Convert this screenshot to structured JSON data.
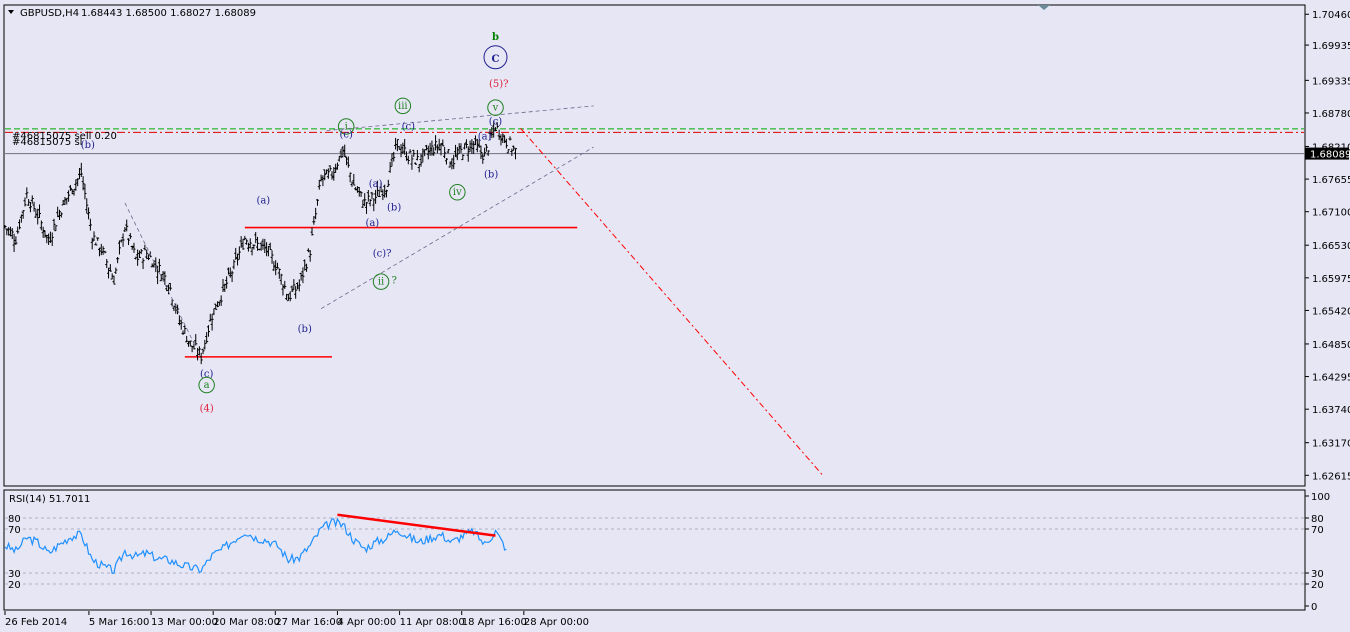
{
  "header": {
    "symbol": "GBPUSD,H4",
    "ohlc": "1.68443 1.68500 1.68027 1.68089"
  },
  "price_panel": {
    "price_labels": [
      "1.70460",
      "1.69935",
      "1.69335",
      "1.68780",
      "1.68210",
      "1.67655",
      "1.67100",
      "1.66530",
      "1.65975",
      "1.65420",
      "1.64850",
      "1.64295",
      "1.63740",
      "1.63170",
      "1.62615"
    ],
    "price_values": [
      1.7046,
      1.69935,
      1.69335,
      1.6878,
      1.6821,
      1.67655,
      1.671,
      1.6653,
      1.65975,
      1.6542,
      1.6485,
      1.64295,
      1.6374,
      1.6317,
      1.62615
    ],
    "current_price_label": "1.68089",
    "current_price": 1.68089,
    "order_lines": [
      {
        "label": "#46815075 sell 0.20",
        "price": 1.6851,
        "color": "#00aa00"
      },
      {
        "label": "#46815075 sl",
        "price": 1.6845,
        "color": "#e00000"
      }
    ],
    "levels": [
      {
        "price": 1.6683,
        "from_day": 22.0,
        "to_day": 52.5,
        "color": "#ff0000"
      },
      {
        "price": 1.6463,
        "from_day": 16.5,
        "to_day": 30.0,
        "color": "#ff0000"
      }
    ],
    "projection": {
      "from_day": 47.3,
      "from_price": 1.6852,
      "to_day": 75.0,
      "to_price": 1.6262,
      "color": "#ff0000"
    },
    "channel_lines": [
      {
        "from_day": 29.5,
        "from_price": 1.6848,
        "to_day": 54.0,
        "to_price": 1.689
      },
      {
        "from_day": 29.0,
        "from_price": 1.6545,
        "to_day": 54.0,
        "to_price": 1.682
      },
      {
        "from_day": 11.0,
        "from_price": 1.6725,
        "to_day": 17.5,
        "to_price": 1.648
      }
    ],
    "wave_labels": [
      {
        "text": "b",
        "day": 45.0,
        "price": 1.7002,
        "color": "#008000",
        "size": 15,
        "circled": false
      },
      {
        "text": "C",
        "day": 45.0,
        "price": 1.6965,
        "color": "#202090",
        "size": 14,
        "circled": true
      },
      {
        "text": "(5)?",
        "day": 45.3,
        "price": 1.6922,
        "color": "#e0203a",
        "size": 11,
        "circled": false
      },
      {
        "text": "v",
        "day": 45.0,
        "price": 1.6882,
        "color": "#208020",
        "size": 9,
        "circled": true
      },
      {
        "text": "(c)",
        "day": 45.0,
        "price": 1.6858,
        "color": "#202090",
        "size": 10,
        "circled": false
      },
      {
        "text": "(a)",
        "day": 44.0,
        "price": 1.6833,
        "color": "#202090",
        "size": 10,
        "circled": false
      },
      {
        "text": "(b)",
        "day": 44.6,
        "price": 1.6768,
        "color": "#202090",
        "size": 10,
        "circled": false
      },
      {
        "text": "iv",
        "day": 41.5,
        "price": 1.6738,
        "color": "#208020",
        "size": 9,
        "circled": true
      },
      {
        "text": "iii",
        "day": 36.5,
        "price": 1.6885,
        "color": "#208020",
        "size": 9,
        "circled": true
      },
      {
        "text": "(c)",
        "day": 37.0,
        "price": 1.685,
        "color": "#202090",
        "size": 10,
        "circled": false
      },
      {
        "text": "i",
        "day": 31.3,
        "price": 1.685,
        "color": "#208020",
        "size": 9,
        "circled": true
      },
      {
        "text": "(c)",
        "day": 31.3,
        "price": 1.6836,
        "color": "#202090",
        "size": 10,
        "circled": false
      },
      {
        "text": "(a)",
        "day": 34.0,
        "price": 1.6752,
        "color": "#202090",
        "size": 10,
        "circled": false
      },
      {
        "text": "(b)",
        "day": 35.7,
        "price": 1.6712,
        "color": "#202090",
        "size": 10,
        "circled": false
      },
      {
        "text": "(a)",
        "day": 33.7,
        "price": 1.6686,
        "color": "#202090",
        "size": 10,
        "circled": false
      },
      {
        "text": "(c)?",
        "day": 34.6,
        "price": 1.6634,
        "color": "#202090",
        "size": 10,
        "circled": false
      },
      {
        "text": "ii",
        "day": 34.5,
        "price": 1.6586,
        "color": "#208020",
        "size": 9,
        "circled": true
      },
      {
        "text": "?",
        "day": 35.7,
        "price": 1.6588,
        "color": "#208020",
        "size": 10,
        "circled": false
      },
      {
        "text": "(a)",
        "day": 23.7,
        "price": 1.6724,
        "color": "#202090",
        "size": 10,
        "circled": false
      },
      {
        "text": "(b)",
        "day": 27.5,
        "price": 1.6505,
        "color": "#202090",
        "size": 10,
        "circled": false
      },
      {
        "text": "(b)",
        "day": 7.6,
        "price": 1.6818,
        "color": "#202090",
        "size": 10,
        "circled": false
      },
      {
        "text": "(c)",
        "day": 18.5,
        "price": 1.6429,
        "color": "#202090",
        "size": 10,
        "circled": false
      },
      {
        "text": "a",
        "day": 18.5,
        "price": 1.641,
        "color": "#208020",
        "size": 9,
        "circled": true
      },
      {
        "text": "(4)",
        "day": 18.5,
        "price": 1.637,
        "color": "#e0203a",
        "size": 11,
        "circled": false
      }
    ]
  },
  "rsi_panel": {
    "title": "RSI(14) 51.7011",
    "axis_labels": [
      "100",
      "80",
      "70",
      "30",
      "20",
      "0"
    ],
    "axis_values": [
      100,
      80,
      70,
      30,
      20,
      0
    ],
    "left_labels": [
      "80",
      "70",
      "30",
      "20"
    ],
    "left_values": [
      80,
      70,
      30,
      20
    ],
    "divergence_line": {
      "from_day": 30.5,
      "from_value": 83,
      "to_day": 45.0,
      "to_value": 64,
      "color": "#ff0000"
    }
  },
  "x_axis": {
    "labels": [
      "26 Feb 2014",
      "5 Mar 16:00",
      "13 Mar 00:00",
      "20 Mar 08:00",
      "27 Mar 16:00",
      "4 Apr 00:00",
      "11 Apr 08:00",
      "18 Apr 16:00",
      "28 Apr 00:00"
    ],
    "label_days": [
      0,
      7.7,
      13.4,
      19.1,
      24.8,
      30.5,
      36.2,
      41.9,
      47.6
    ]
  },
  "chart_data": {
    "type": "line",
    "title": "GBPUSD,H4",
    "series": [
      {
        "name": "GBPUSD,H4",
        "x_days": [
          0,
          1,
          2,
          3,
          4,
          5,
          6,
          7,
          8,
          9,
          10,
          11,
          12,
          13,
          14,
          15,
          16,
          17,
          18,
          19,
          20,
          21,
          22,
          23,
          24,
          25,
          26,
          27,
          28,
          29,
          30,
          31,
          32,
          33,
          34,
          35,
          36,
          37,
          38,
          39,
          40,
          41,
          42,
          43,
          44,
          45,
          46,
          47
        ],
        "values": [
          1.6685,
          1.6665,
          1.674,
          1.6705,
          1.666,
          1.671,
          1.6745,
          1.6775,
          1.667,
          1.664,
          1.6595,
          1.6685,
          1.663,
          1.664,
          1.6615,
          1.659,
          1.6525,
          1.6485,
          1.6465,
          1.6535,
          1.6575,
          1.6615,
          1.6665,
          1.6655,
          1.6645,
          1.6615,
          1.6565,
          1.6585,
          1.6645,
          1.6765,
          1.6775,
          1.6815,
          1.6755,
          1.6725,
          1.6735,
          1.6755,
          1.6825,
          1.6805,
          1.6795,
          1.6815,
          1.6825,
          1.6795,
          1.6815,
          1.6825,
          1.6805,
          1.6855,
          1.683,
          1.6809
        ]
      },
      {
        "name": "RSI(14)",
        "x_days": [
          0,
          1,
          2,
          3,
          4,
          5,
          6,
          7,
          8,
          9,
          10,
          11,
          12,
          13,
          14,
          15,
          16,
          17,
          18,
          19,
          20,
          21,
          22,
          23,
          24,
          25,
          26,
          27,
          28,
          29,
          30,
          31,
          32,
          33,
          34,
          35,
          36,
          37,
          38,
          39,
          40,
          41,
          42,
          43,
          44,
          45,
          46
        ],
        "values": [
          55,
          50,
          62,
          58,
          48,
          56,
          63,
          65,
          42,
          36,
          32,
          50,
          45,
          48,
          43,
          42,
          38,
          35,
          33,
          46,
          52,
          60,
          68,
          62,
          60,
          55,
          42,
          44,
          55,
          70,
          76,
          74,
          60,
          52,
          58,
          62,
          70,
          63,
          58,
          62,
          65,
          58,
          64,
          68,
          56,
          68,
          51.7
        ]
      }
    ],
    "ylim": [
      1.6245,
      1.706
    ]
  }
}
